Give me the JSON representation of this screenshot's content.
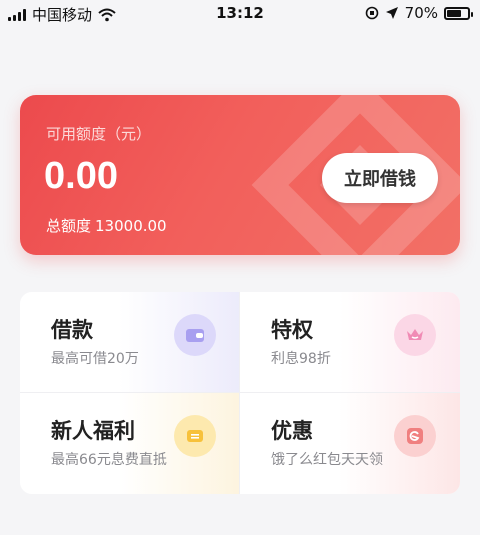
{
  "status_bar": {
    "carrier": "中国移动",
    "time": "13:12",
    "battery_percent": "70%",
    "battery_level": 0.7
  },
  "credit_card": {
    "label": "可用额度（元）",
    "available_amount": "0.00",
    "total_label": "总额度",
    "total_amount": "13000.00",
    "borrow_button": "立即借钱"
  },
  "services": [
    {
      "title": "借款",
      "subtitle": "最高可借20万",
      "icon": "wallet-icon",
      "color": "#b9b2f3"
    },
    {
      "title": "特权",
      "subtitle": "利息98折",
      "icon": "crown-icon",
      "color": "#f6a3c6"
    },
    {
      "title": "新人福利",
      "subtitle": "最高66元息费直抵",
      "icon": "coupon-icon",
      "color": "#f9c94a"
    },
    {
      "title": "优惠",
      "subtitle": "饿了么红包天天领",
      "icon": "discount-icon",
      "color": "#f48b8b"
    }
  ]
}
